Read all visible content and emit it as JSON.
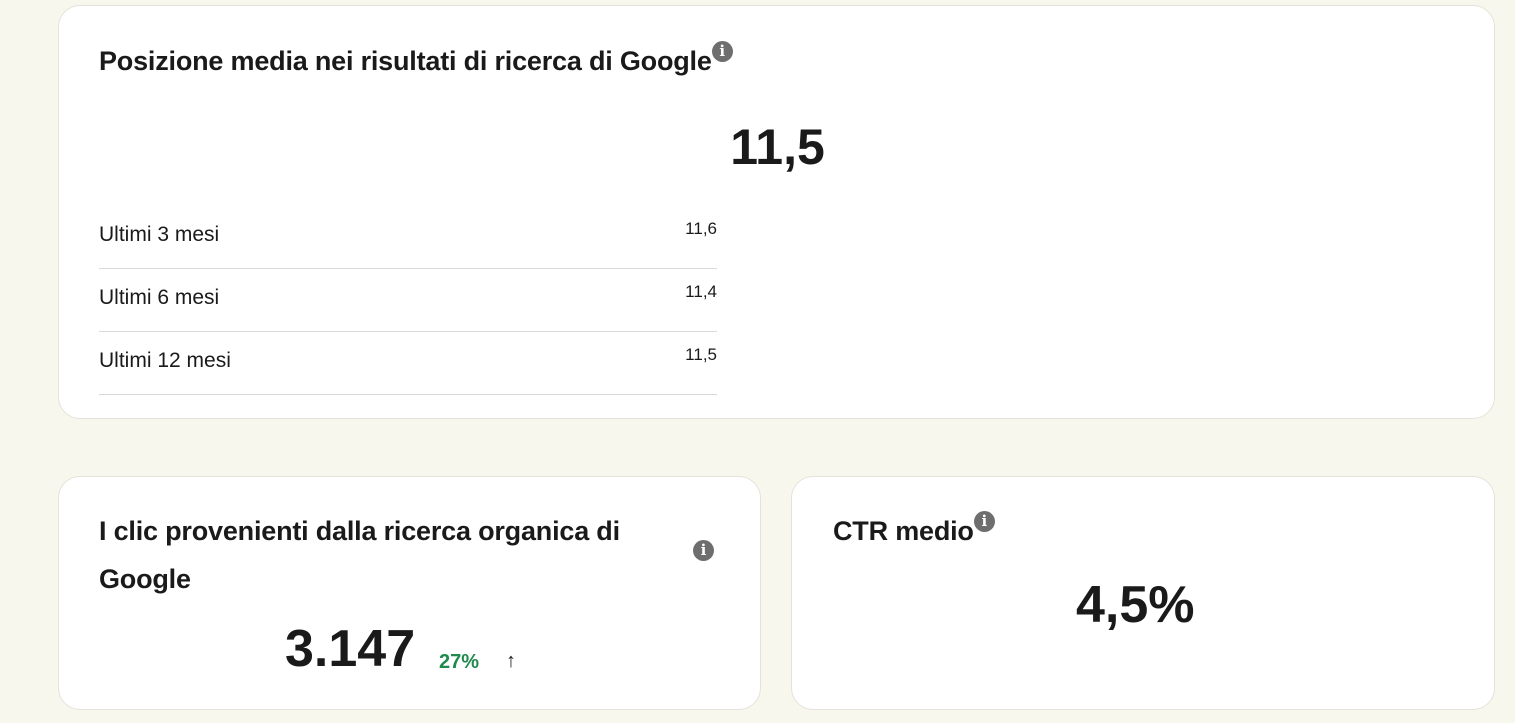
{
  "position_card": {
    "title": "Posizione media nei risultati di ricerca di Google",
    "info_icon": "info-icon",
    "value": "11,5",
    "periods": [
      {
        "label": "Ultimi 3 mesi",
        "value": "11,6"
      },
      {
        "label": "Ultimi 6 mesi",
        "value": "11,4"
      },
      {
        "label": "Ultimi 12 mesi",
        "value": "11,5"
      }
    ]
  },
  "clicks_card": {
    "title": "I clic provenienti dalla ricerca organica di Google",
    "info_icon": "info-icon",
    "value": "3.147",
    "change": "27%",
    "change_direction_icon": "arrow-up-icon",
    "change_arrow": "↑"
  },
  "ctr_card": {
    "title": "CTR medio",
    "info_icon": "info-icon",
    "value": "4,5%"
  },
  "colors": {
    "background": "#f8f7ee",
    "card": "#ffffff",
    "text": "#1a1a1a",
    "positive_trend": "#1f8a4c",
    "info_icon": "#6e6e6e",
    "divider": "#d9d9d9"
  }
}
